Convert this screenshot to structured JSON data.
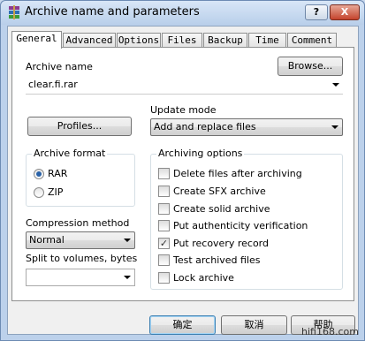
{
  "window": {
    "title": "Archive name and parameters",
    "help_label": "?",
    "close_label": "X"
  },
  "tabs": [
    {
      "label": "General"
    },
    {
      "label": "Advanced"
    },
    {
      "label": "Options"
    },
    {
      "label": "Files"
    },
    {
      "label": "Backup"
    },
    {
      "label": "Time"
    },
    {
      "label": "Comment"
    }
  ],
  "general": {
    "archive_name_label": "Archive name",
    "browse_label": "Browse...",
    "archive_name_value": "clear.fi.rar",
    "profiles_label": "Profiles...",
    "update_mode_label": "Update mode",
    "update_mode_value": "Add and replace files",
    "archive_format": {
      "title": "Archive format",
      "options": [
        {
          "label": "RAR",
          "selected": true
        },
        {
          "label": "ZIP",
          "selected": false
        }
      ]
    },
    "archiving_options": {
      "title": "Archiving options",
      "items": [
        {
          "label": "Delete files after archiving",
          "checked": false
        },
        {
          "label": "Create SFX archive",
          "checked": false
        },
        {
          "label": "Create solid archive",
          "checked": false
        },
        {
          "label": "Put authenticity verification",
          "checked": false
        },
        {
          "label": "Put recovery record",
          "checked": true
        },
        {
          "label": "Test archived files",
          "checked": false
        },
        {
          "label": "Lock archive",
          "checked": false
        }
      ]
    },
    "compression_label": "Compression method",
    "compression_value": "Normal",
    "split_label": "Split to volumes, bytes",
    "split_value": ""
  },
  "footer": {
    "ok_label": "确定",
    "cancel_label": "取消",
    "help_label": "帮助"
  },
  "watermark": "hifi168.com"
}
